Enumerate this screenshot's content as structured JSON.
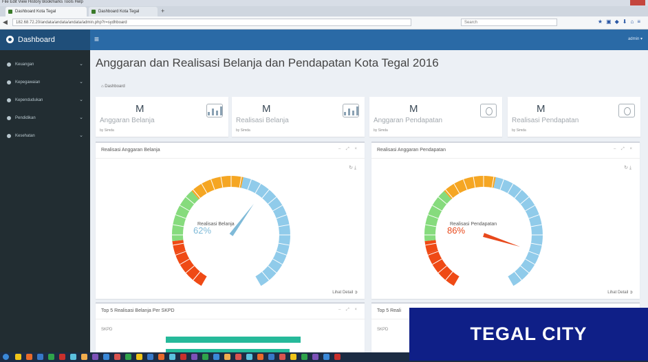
{
  "browser": {
    "menu": "File  Edit  View  History  Bookmarks  Tools  Help",
    "tabs": [
      "Dashboard Kota Tegal",
      "Dashboard Kota Tegal"
    ],
    "new_tab": "+",
    "url": "182.68.72.20/andata/andata/andata/admin.php?r=sydhboard",
    "search_placeholder": "Search"
  },
  "sidebar": {
    "brand": "Dashboard",
    "items": [
      {
        "label": "Keuangan"
      },
      {
        "label": "Kepegawaian"
      },
      {
        "label": "Kependudukan"
      },
      {
        "label": "Pendidikan"
      },
      {
        "label": "Kesehatan"
      }
    ]
  },
  "header": {
    "menu_icon": "≡",
    "user": "admin ▾"
  },
  "page": {
    "title": "Anggaran dan Realisasi Belanja dan Pendapatan Kota Tegal 2016",
    "breadcrumb": "Dashboard"
  },
  "stats": [
    {
      "value": "M",
      "label": "Anggaran Belanja",
      "source": "by Simda",
      "icon": "bar-chart-icon"
    },
    {
      "value": "M",
      "label": "Realisasi Belanja",
      "source": "by Simda",
      "icon": "bar-chart-icon"
    },
    {
      "value": "M",
      "label": "Anggaran Pendapatan",
      "source": "by Simda",
      "icon": "money-icon"
    },
    {
      "value": "M",
      "label": "Realisasi Pendapatan",
      "source": "by Simda",
      "icon": "money-icon"
    }
  ],
  "panels": {
    "belanja": {
      "title": "Realisasi Anggaran Belanja",
      "gauge_label": "Realisasi Belanja",
      "percent": 62,
      "percent_text": "62%",
      "needle_color": "#7fbad8",
      "detail": "Lihat Detail"
    },
    "pendapatan": {
      "title": "Realisasi Anggaran Pendapatan",
      "gauge_label": "Realisasi Pendapatan",
      "percent": 86,
      "percent_text": "86%",
      "needle_color": "#e8491c",
      "detail": "Lihat Detail"
    },
    "top_belanja": {
      "title": "Top 5 Realisasi Belanja Per SKPD",
      "column": "SKPD"
    },
    "top_pendapatan": {
      "title": "Top 5 Reali",
      "column": "SKPD"
    }
  },
  "gauge_colors": {
    "green": "#86db7d",
    "orange": "#f5a623",
    "blue": "#90cbea",
    "red": "#ef4a15"
  },
  "overlay": {
    "text": "TEGAL CITY"
  }
}
